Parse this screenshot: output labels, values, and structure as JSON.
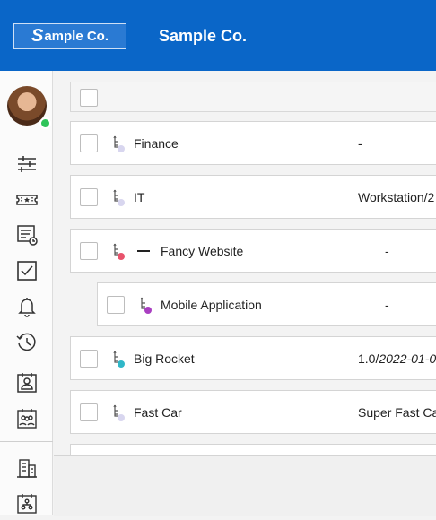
{
  "header": {
    "logo_text": "ample Co.",
    "logo_initial": "S",
    "title": "Sample Co."
  },
  "sidebar": {
    "items": [
      {
        "name": "sliders-icon"
      },
      {
        "name": "ticket-icon"
      },
      {
        "name": "document-clock-icon"
      },
      {
        "name": "checkbox-icon"
      },
      {
        "name": "bell-icon"
      },
      {
        "name": "clock-history-icon"
      },
      {
        "name": "contact-card-icon"
      },
      {
        "name": "team-calendar-icon"
      },
      {
        "name": "building-icon"
      },
      {
        "name": "org-chart-icon"
      }
    ],
    "status": "online"
  },
  "table": {
    "rows": [
      {
        "name": "Finance",
        "version": "-",
        "version_date": "",
        "dot_color": "#d8d6ef"
      },
      {
        "name": "IT",
        "version": "Workstation/2",
        "version_date": "",
        "dot_color": "#d8d6ef"
      },
      {
        "name": "Fancy Website",
        "version": "-",
        "version_date": "",
        "dot_color": "#e8536c",
        "collapse": "—"
      },
      {
        "name": "Mobile Application",
        "version": "-",
        "version_date": "",
        "dot_color": "#a93fc1"
      },
      {
        "name": "Big Rocket",
        "version": "1.0/",
        "version_date": "2022-01-0",
        "dot_color": "#2fb7c8"
      },
      {
        "name": "Fast Car",
        "version": "Super Fast Ca",
        "version_date": "",
        "dot_color": "#d8d6ef"
      }
    ]
  },
  "colors": {
    "brand": "#0a66c8",
    "online": "#2fc45a"
  }
}
